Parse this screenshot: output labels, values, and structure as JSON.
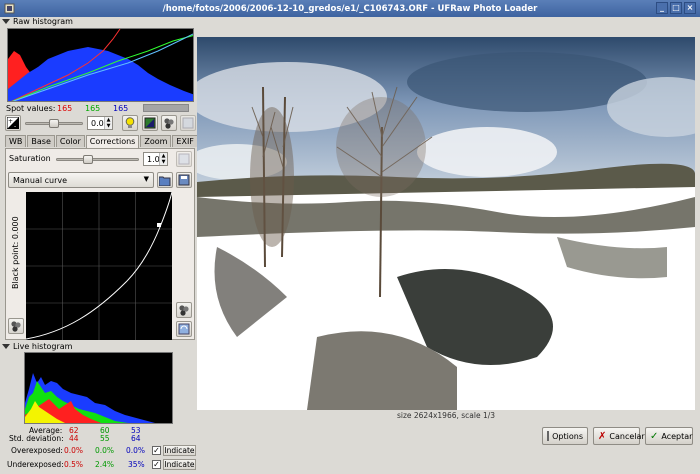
{
  "window": {
    "title": "/home/fotos/2006/2006-12-10_gredos/e1/_C106743.ORF - UFRaw Photo Loader"
  },
  "raw_histogram": {
    "label": "Raw histogram"
  },
  "spot_values": {
    "label": "Spot values:",
    "r": "165",
    "g": "165",
    "b": "165"
  },
  "exposure": {
    "value": "0.00",
    "level": 0.5
  },
  "tabs": [
    "WB",
    "Base",
    "Color",
    "Corrections",
    "Zoom",
    "EXIF"
  ],
  "active_tab": "Corrections",
  "saturation": {
    "label": "Saturation",
    "value": "1.00",
    "level": 0.38
  },
  "curve": {
    "selected": "Manual curve",
    "black_point_label": "Black point: 0.000"
  },
  "live_histogram": {
    "label": "Live histogram"
  },
  "stats": {
    "average_label": "Average:",
    "average": [
      "62",
      "60",
      "53"
    ],
    "std_label": "Std. deviation:",
    "std": [
      "44",
      "55",
      "64"
    ],
    "over_label": "Overexposed:",
    "over": [
      "0.0%",
      "0.0%",
      "0.0%"
    ],
    "under_label": "Underexposed:",
    "under": [
      "0.5%",
      "2.4%",
      "35%"
    ],
    "indicate_label": "Indicate"
  },
  "image": {
    "size_text": "size 2624x1966, scale 1/3"
  },
  "buttons": {
    "options": "Options",
    "cancel": "Cancelar",
    "accept": "Aceptar"
  },
  "colors": {
    "red": "#cc0000",
    "green": "#009900",
    "blue": "#0000bb"
  }
}
